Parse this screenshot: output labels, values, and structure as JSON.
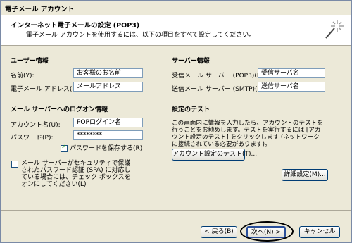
{
  "window": {
    "title": "電子メール アカウント"
  },
  "header": {
    "title": "インターネット電子メールの設定 (POP3)",
    "subtitle": "電子メール アカウントを使用するには、以下の項目をすべて設定してください。",
    "icon": "wand-sparkle-icon"
  },
  "user_info": {
    "heading": "ユーザー情報",
    "name_label": "名前(Y):",
    "name_value": "お客様のお名前",
    "email_label": "電子メール アドレス(E):",
    "email_value": "メールアドレス"
  },
  "logon_info": {
    "heading": "メール サーバーへのログオン情報",
    "account_label": "アカウント名(U):",
    "account_value": "POPログイン名",
    "password_label": "パスワード(P):",
    "password_value": "********",
    "remember_label": "パスワードを保存する(R)",
    "remember_checked": true,
    "spa_label": "メール サーバーがセキュリティで保護されたパスワード認証 (SPA) に対応している場合には、チェック ボックスをオンにしてください(L)",
    "spa_checked": false
  },
  "server_info": {
    "heading": "サーバー情報",
    "incoming_label": "受信メール サーバー (POP3)(I):",
    "incoming_value": "受信サーバ名",
    "outgoing_label": "送信メール サーバー (SMTP)(O):",
    "outgoing_value": "送信サーバ名"
  },
  "test": {
    "heading": "設定のテスト",
    "description": "この画面内に情報を入力したら、アカウントのテストを行うことをお勧めします。テストを実行するには [アカウント設定のテスト] をクリックします (ネットワークに接続されている必要があります)。",
    "test_button": "アカウント設定のテスト(T)...",
    "advanced_button": "詳細設定(M)..."
  },
  "footer": {
    "back_button": "< 戻る(B)",
    "next_button": "次へ(N) >",
    "cancel_button": "キャンセル"
  }
}
